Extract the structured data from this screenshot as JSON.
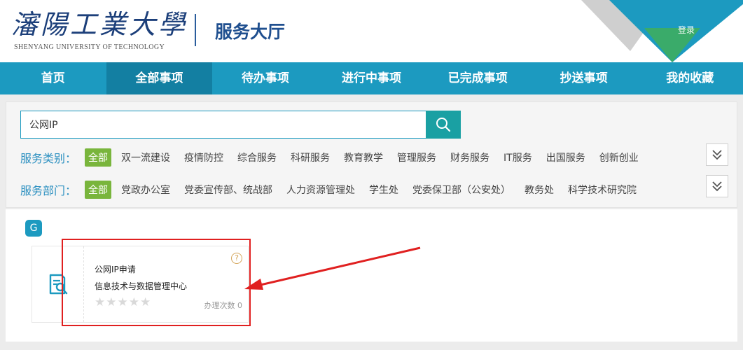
{
  "header": {
    "logo_cn": "瀋陽工業大學",
    "logo_en": "SHENYANG UNIVERSITY OF TECHNOLOGY",
    "hall_title": "服务大厅",
    "login_label": "登录"
  },
  "nav": {
    "items": [
      {
        "label": "首页"
      },
      {
        "label": "全部事项",
        "active": true
      },
      {
        "label": "待办事项"
      },
      {
        "label": "进行中事项"
      },
      {
        "label": "已完成事项"
      },
      {
        "label": "抄送事项"
      },
      {
        "label": "我的收藏"
      }
    ]
  },
  "search": {
    "value": "公网IP",
    "icon": "search-icon"
  },
  "filters": {
    "category": {
      "label": "服务类别：",
      "tags": [
        "全部",
        "双一流建设",
        "疫情防控",
        "综合服务",
        "科研服务",
        "教育教学",
        "管理服务",
        "财务服务",
        "IT服务",
        "出国服务",
        "创新创业"
      ]
    },
    "department": {
      "label": "服务部门：",
      "tags": [
        "全部",
        "党政办公室",
        "党委宣传部、统战部",
        "人力资源管理处",
        "学生处",
        "党委保卫部（公安处）",
        "教务处",
        "科学技术研究院"
      ]
    }
  },
  "results": {
    "group_letter": "G",
    "cards": [
      {
        "title": "公网IP申请",
        "department": "信息技术与数据管理中心",
        "rating": 0,
        "count_label": "办理次数 0",
        "help": "?"
      }
    ]
  },
  "colors": {
    "nav_bg": "#1c9ac0",
    "nav_active": "#137fa2",
    "tag_active": "#79b53c",
    "annotation": "#e02020"
  }
}
